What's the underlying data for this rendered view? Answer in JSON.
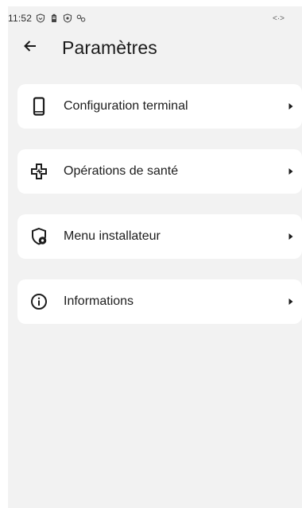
{
  "status_bar": {
    "time": "11:52",
    "right_indicator": "<·>",
    "icons": [
      "shield-wifi-icon",
      "battery-icon",
      "vpn-shield-icon",
      "link-icon"
    ]
  },
  "header": {
    "title": "Paramètres",
    "back_icon": "arrow-left-icon"
  },
  "menu": {
    "items": [
      {
        "label": "Configuration terminal",
        "icon": "phone-icon"
      },
      {
        "label": "Opérations de santé",
        "icon": "medical-cross-icon"
      },
      {
        "label": "Menu installateur",
        "icon": "shield-gear-icon"
      },
      {
        "label": "Informations",
        "icon": "info-icon"
      }
    ],
    "chevron_icon": "chevron-right-icon"
  },
  "colors": {
    "background": "#f2f2f2",
    "card": "#ffffff",
    "text": "#1d1d1d"
  }
}
